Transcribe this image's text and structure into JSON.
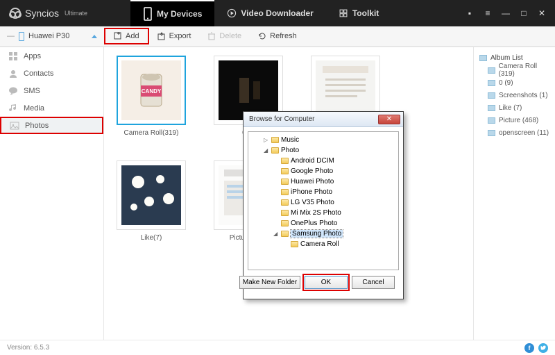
{
  "app": {
    "name": "Syncios",
    "edition": "Ultimate"
  },
  "nav": {
    "items": [
      {
        "label": "My Devices",
        "active": true
      },
      {
        "label": "Video Downloader",
        "active": false
      },
      {
        "label": "Toolkit",
        "active": false
      }
    ]
  },
  "device": {
    "name": "Huawei P30"
  },
  "toolbar": {
    "add": "Add",
    "export": "Export",
    "delete": "Delete",
    "refresh": "Refresh"
  },
  "sidebar": {
    "items": [
      {
        "label": "Apps"
      },
      {
        "label": "Contacts"
      },
      {
        "label": "SMS"
      },
      {
        "label": "Media"
      },
      {
        "label": "Photos"
      }
    ],
    "selected": "Photos"
  },
  "thumbs": [
    {
      "label": "Camera Roll(319)",
      "selected": true
    },
    {
      "label": "0(9)"
    },
    {
      "label": "Screenshots(1)"
    },
    {
      "label": "Like(7)"
    },
    {
      "label": "Picture(468)"
    },
    {
      "label": "openscreen(11)"
    }
  ],
  "albums": {
    "title": "Album List",
    "items": [
      {
        "label": "Camera Roll (319)"
      },
      {
        "label": "0 (9)"
      },
      {
        "label": "Screenshots (1)"
      },
      {
        "label": "Like (7)"
      },
      {
        "label": "Picture (468)"
      },
      {
        "label": "openscreen (11)"
      }
    ]
  },
  "dialog": {
    "title": "Browse for Computer",
    "tree": [
      {
        "label": "Music",
        "indent": 1,
        "exp": "▷"
      },
      {
        "label": "Photo",
        "indent": 1,
        "exp": "◢"
      },
      {
        "label": "Android DCIM",
        "indent": 2
      },
      {
        "label": "Google Photo",
        "indent": 2
      },
      {
        "label": "Huawei Photo",
        "indent": 2
      },
      {
        "label": "iPhone Photo",
        "indent": 2
      },
      {
        "label": "LG V35 Photo",
        "indent": 2
      },
      {
        "label": "Mi Mix 2S Photo",
        "indent": 2
      },
      {
        "label": "OnePlus Photo",
        "indent": 2
      },
      {
        "label": "Samsung Photo",
        "indent": 2,
        "exp": "◢",
        "selected": true
      },
      {
        "label": "Camera Roll",
        "indent": 3
      }
    ],
    "make": "Make New Folder",
    "ok": "OK",
    "cancel": "Cancel"
  },
  "footer": {
    "version": "Version: 6.5.3"
  }
}
